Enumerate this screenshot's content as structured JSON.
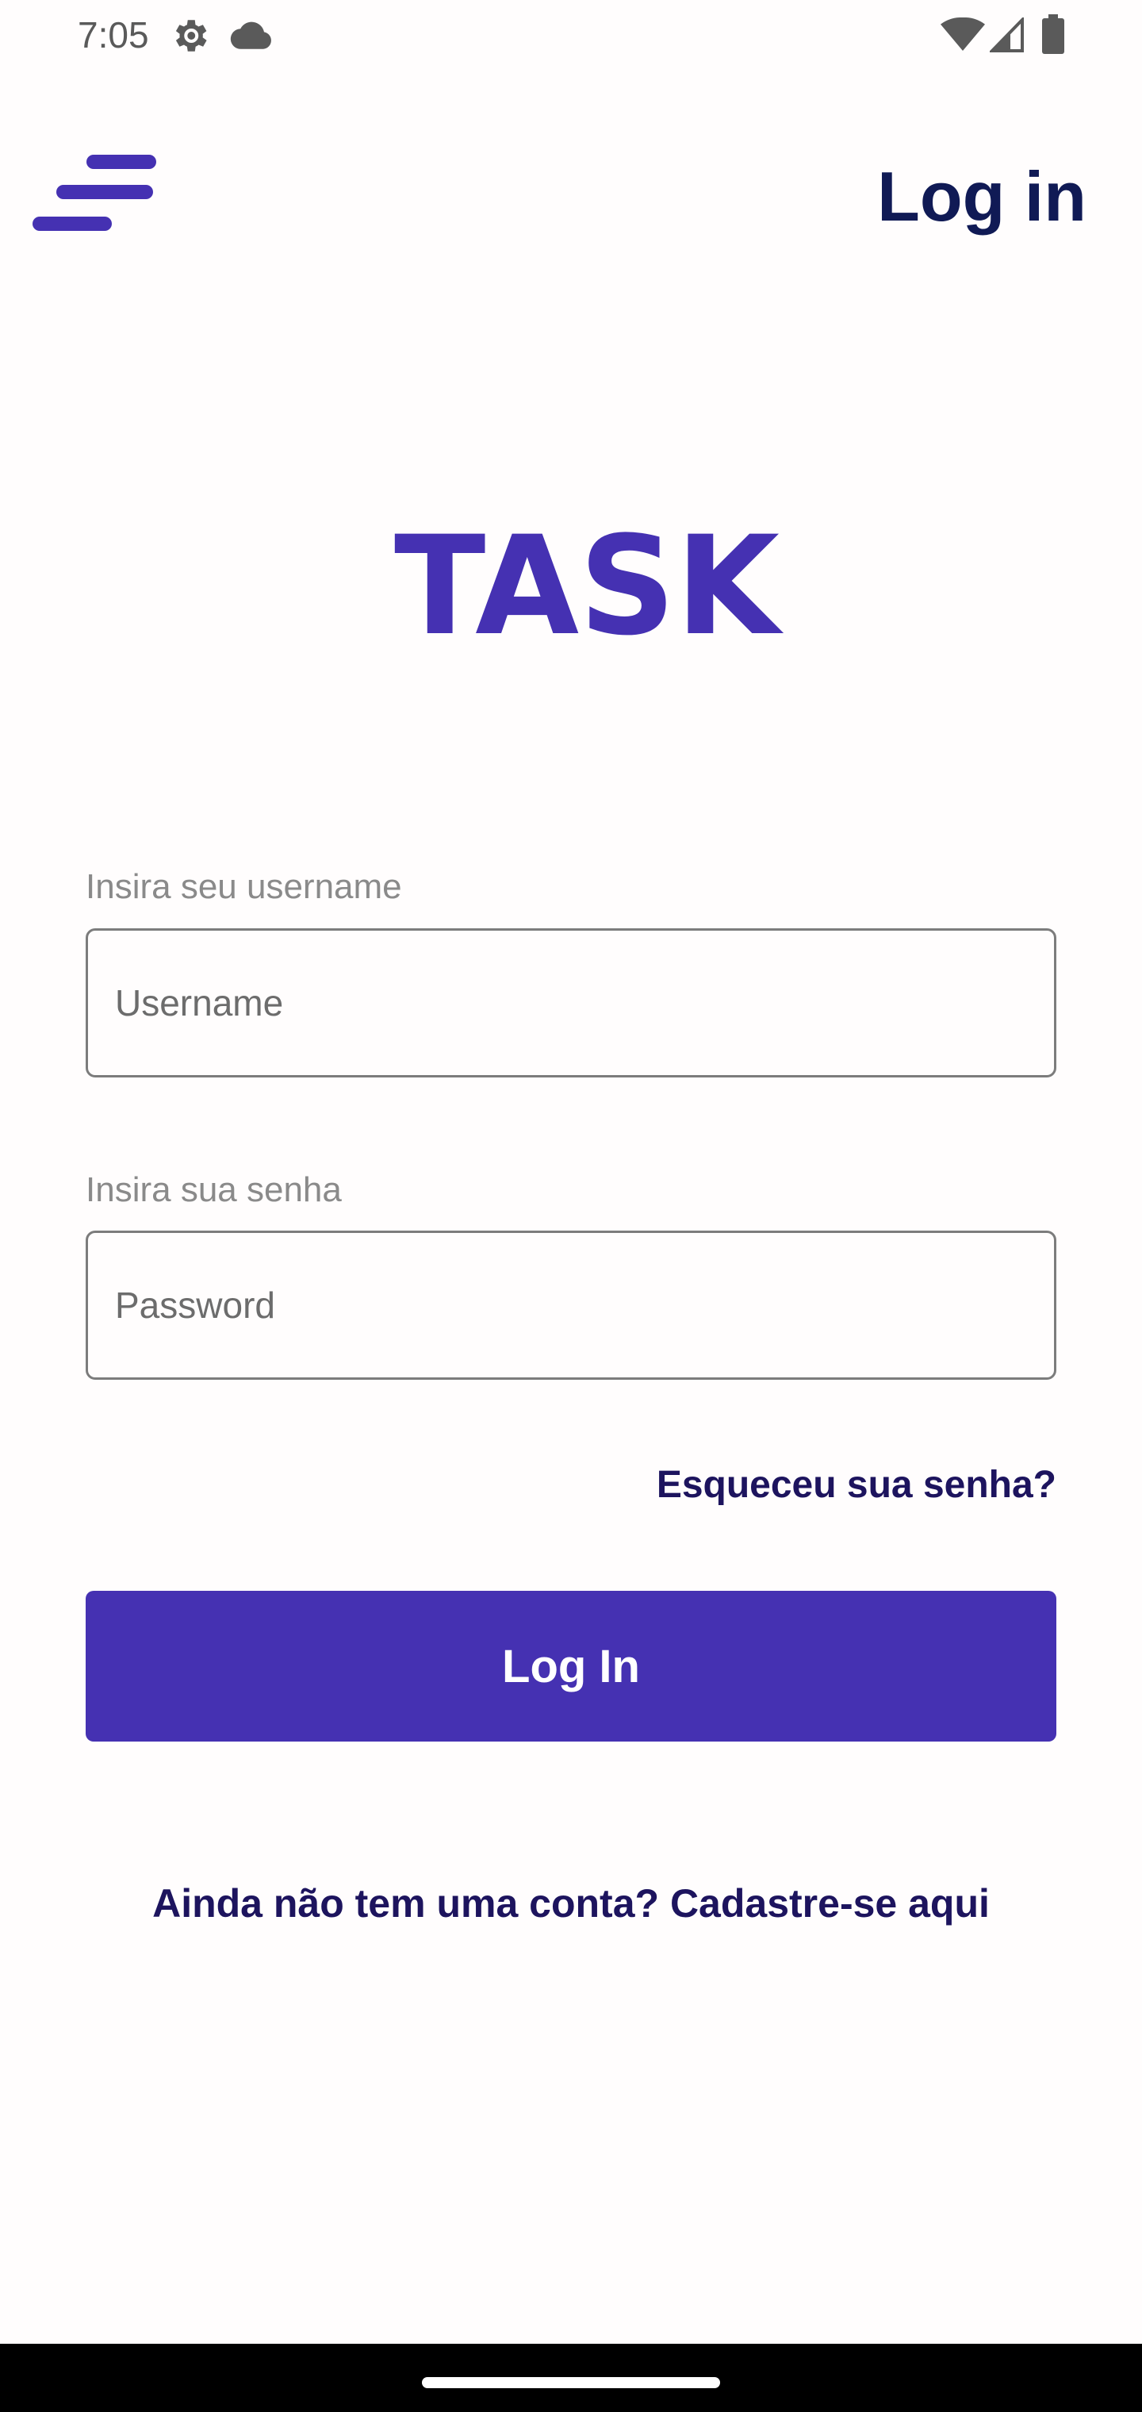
{
  "status_bar": {
    "time": "7:05",
    "icons": [
      "gear-icon",
      "cloud-icon",
      "wifi-icon",
      "signal-icon",
      "battery-icon"
    ]
  },
  "header": {
    "menu_icon": "menu-icon",
    "title": "Log in"
  },
  "logo": {
    "text": "TASK"
  },
  "form": {
    "username": {
      "label": "Insira seu username",
      "placeholder": "Username",
      "value": ""
    },
    "password": {
      "label": "Insira sua senha",
      "placeholder": "Password",
      "value": ""
    },
    "forgot_password": "Esqueceu sua senha?",
    "submit_label": "Log In",
    "signup_prompt": "Ainda não tem uma conta? Cadastre-se aqui"
  },
  "colors": {
    "brand": "#4531b2",
    "header_text": "#101a55",
    "link_text": "#1d145e",
    "label_text": "#8a8a8a",
    "background": "#fffdfd"
  }
}
